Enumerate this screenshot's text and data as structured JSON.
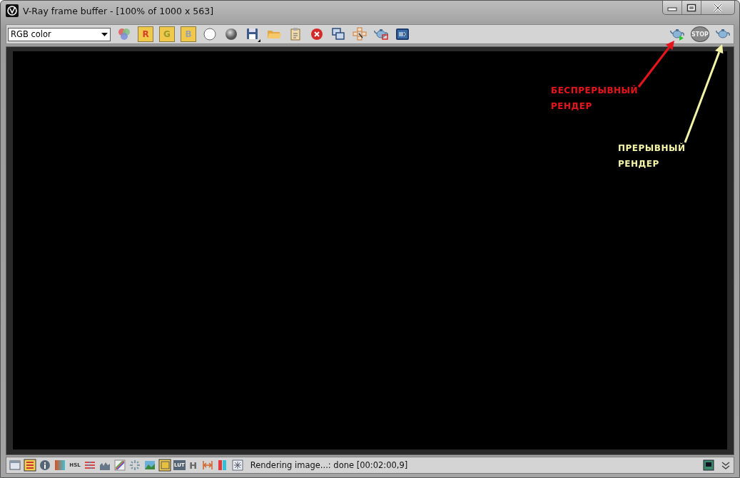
{
  "window": {
    "title": "V-Ray frame buffer - [100% of 1000 x 563]"
  },
  "toolbar": {
    "channel_select": {
      "value": "RGB color"
    },
    "channel_buttons": [
      {
        "label": "R",
        "on": true
      },
      {
        "label": "G",
        "on": true
      },
      {
        "label": "B",
        "on": true
      }
    ],
    "stop_label": "STOP"
  },
  "annotations": [
    {
      "text": "БЕСПРЕРЫВНЫЙ РЕНДЕР",
      "color": "#e8141b"
    },
    {
      "text": "ПРЕРЫВНЫЙ РЕНДЕР",
      "color": "#f4f4a8"
    }
  ],
  "status_bar": {
    "hsl_label": "HSL",
    "lut_label": "LUT",
    "h_label": "H",
    "message": "Rendering image...: done [00:02:00,9]"
  }
}
